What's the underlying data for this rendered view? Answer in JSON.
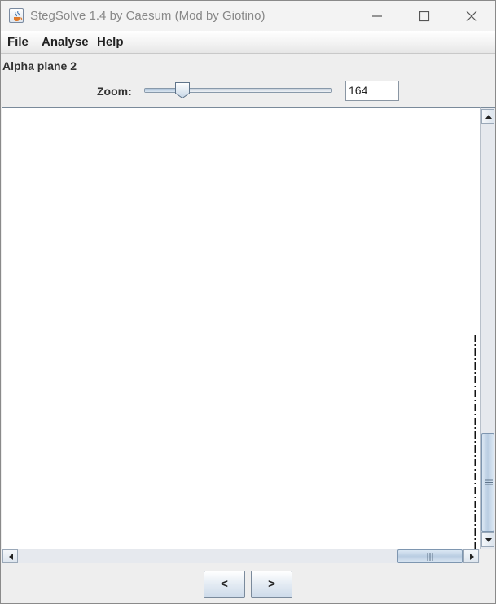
{
  "window": {
    "title": "StegSolve 1.4 by Caesum (Mod by Giotino)"
  },
  "menu": {
    "items": [
      {
        "label": "File"
      },
      {
        "label": "Analyse"
      },
      {
        "label": "Help"
      }
    ]
  },
  "view": {
    "plane_label": "Alpha plane 2"
  },
  "zoom": {
    "label": "Zoom:",
    "value": "164",
    "slider_fraction": 0.16
  },
  "navigation": {
    "prev_label": "<",
    "next_label": ">"
  },
  "icons": {
    "app": "java-cup-icon",
    "minimize": "minimize-icon",
    "maximize": "maximize-icon",
    "close": "close-icon"
  },
  "colors": {
    "window_bg": "#eeeeee",
    "image_bg": "#ffffff",
    "accent": "#b9cde2"
  }
}
